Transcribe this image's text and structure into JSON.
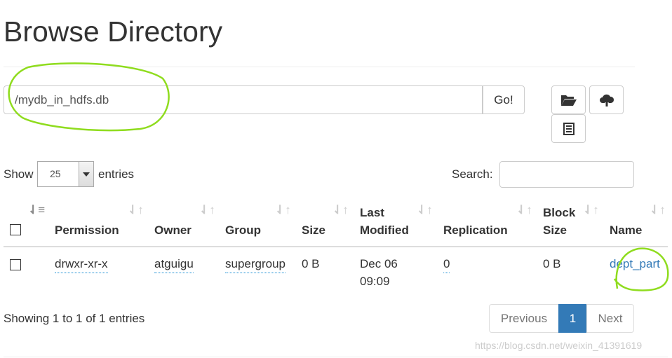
{
  "title": "Browse Directory",
  "path_input": {
    "value": "/mydb_in_hdfs.db"
  },
  "go_label": "Go!",
  "toolbar": {
    "icons": [
      "folder-open-icon",
      "cloud-upload-icon",
      "list-icon"
    ]
  },
  "length": {
    "show": "Show",
    "value": "25",
    "entries": "entries"
  },
  "search": {
    "label": "Search:",
    "value": ""
  },
  "table": {
    "headers": [
      "Permission",
      "Owner",
      "Group",
      "Size",
      "Last Modified",
      "Replication",
      "Block Size",
      "Name"
    ],
    "rows": [
      {
        "permission": "drwxr-xr-x",
        "owner": "atguigu",
        "group": "supergroup",
        "size": "0 B",
        "modified_date": "Dec 06",
        "modified_time": "09:09",
        "replication": "0",
        "block_size": "0 B",
        "name": "dept_part"
      }
    ]
  },
  "info": "Showing 1 to 1 of 1 entries",
  "pagination": {
    "previous": "Previous",
    "current": "1",
    "next": "Next"
  },
  "watermark": "https://blog.csdn.net/weixin_41391619",
  "colors": {
    "accent": "#337ab7",
    "annotation": "#8fdc1e"
  }
}
